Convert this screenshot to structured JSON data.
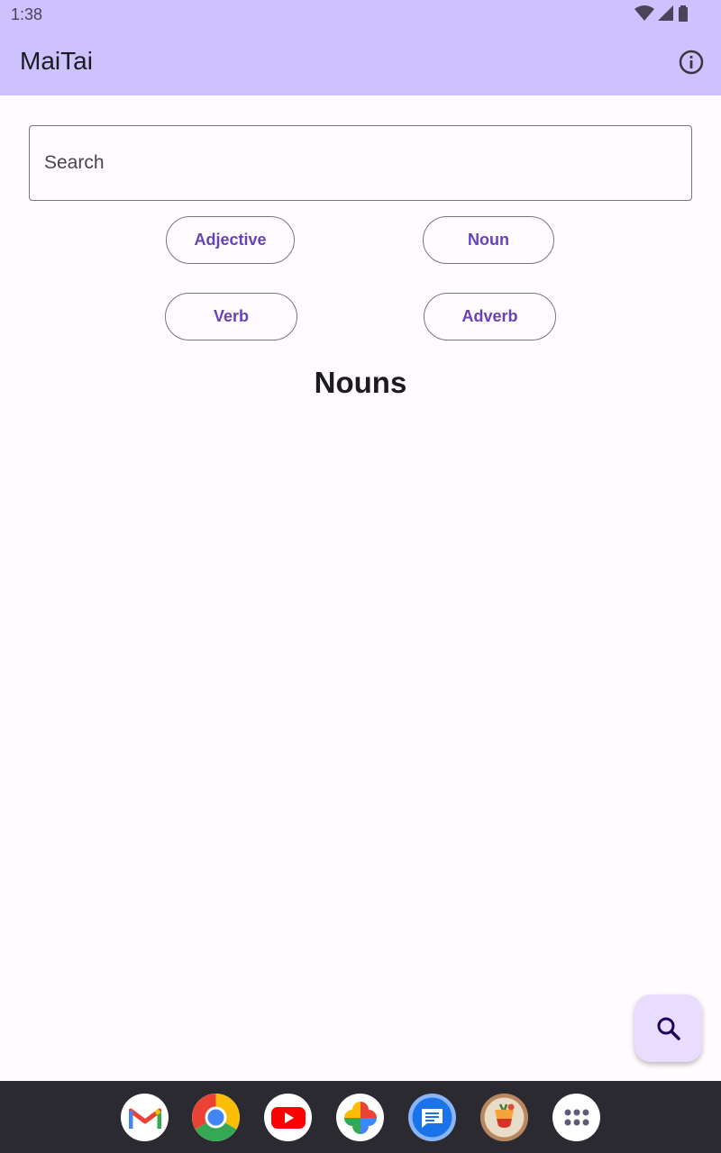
{
  "status_bar": {
    "time": "1:38"
  },
  "app_bar": {
    "title": "MaiTai",
    "info_icon": "info-icon"
  },
  "search": {
    "placeholder": "Search",
    "value": ""
  },
  "filters": [
    {
      "label": "Adjective"
    },
    {
      "label": "Noun"
    },
    {
      "label": "Verb"
    },
    {
      "label": "Adverb"
    }
  ],
  "section": {
    "title": "Nouns"
  },
  "fab": {
    "icon": "search-icon"
  },
  "taskbar": {
    "apps": [
      "gmail",
      "chrome",
      "youtube",
      "photos",
      "messages",
      "cocktail-app",
      "app-drawer"
    ]
  },
  "colors": {
    "app_bar": "#cdc1ff",
    "accent": "#6741b6",
    "background": "#fffbfe",
    "fab": "#e9ddff",
    "taskbar": "#2b2a30"
  }
}
